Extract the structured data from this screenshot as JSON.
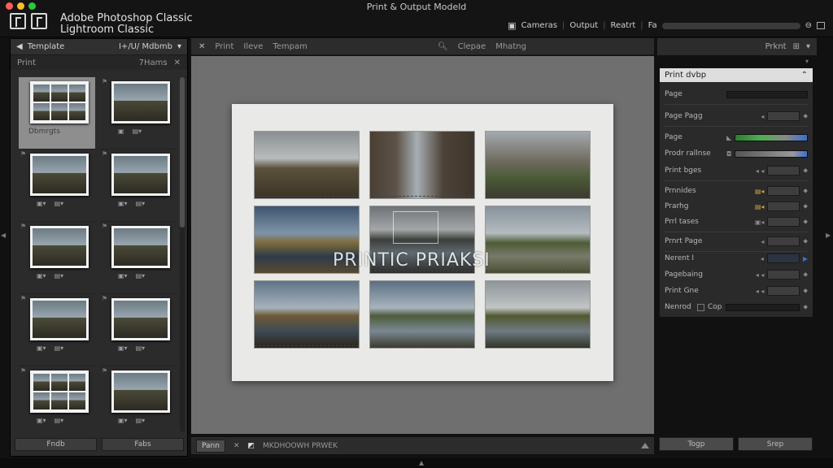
{
  "window": {
    "title": "Print & Output Modeld"
  },
  "app": {
    "name_line1": "Adobe Photoshop Classic",
    "name_line2": "Lightroom Classic"
  },
  "modules": {
    "items": [
      "Cameras",
      "Output",
      "Reatrt",
      "Fa"
    ]
  },
  "left_panel": {
    "template_label": "Template",
    "header_right": "I+/U/ Mdbmb",
    "print_label": "Print",
    "print_right": "7Hams",
    "selected_label": "Dbmrgts",
    "footer_buttons": [
      "Fndb",
      "Fabs"
    ]
  },
  "center": {
    "toolbar": {
      "print": "Print",
      "item2": "Ileve",
      "item3": "Tempam",
      "item4": "Clepae",
      "item5": "Mhatng"
    },
    "watermark": "PRINTIC PRIAKSI",
    "footer": {
      "button": "Pann",
      "label": "MKDHOOWH PRWEK"
    }
  },
  "right_panel": {
    "top_label": "Prknt",
    "header": "Print dvbp",
    "rows": [
      {
        "label": "Page"
      },
      {
        "label": "Page Pagg"
      },
      {
        "label": "Page"
      },
      {
        "label": "Prodr rallnse"
      },
      {
        "label": "Print bges"
      },
      {
        "label": "Prnnides"
      },
      {
        "label": "Prarhg"
      },
      {
        "label": "Prrl tases"
      },
      {
        "label": "Prnrt Page"
      },
      {
        "label": "Nerent I"
      },
      {
        "label": "Pagebaing"
      },
      {
        "label": "Print Gne"
      },
      {
        "label": "Nenrod",
        "value": "Cop"
      }
    ],
    "footer_buttons": [
      "Togp",
      "Srep"
    ]
  },
  "colors": {
    "accent_green": "#4caf50",
    "accent_blue": "#3a6fcf",
    "panel_bg": "#2b2b2b",
    "canvas_bg": "#6f6f6f"
  }
}
